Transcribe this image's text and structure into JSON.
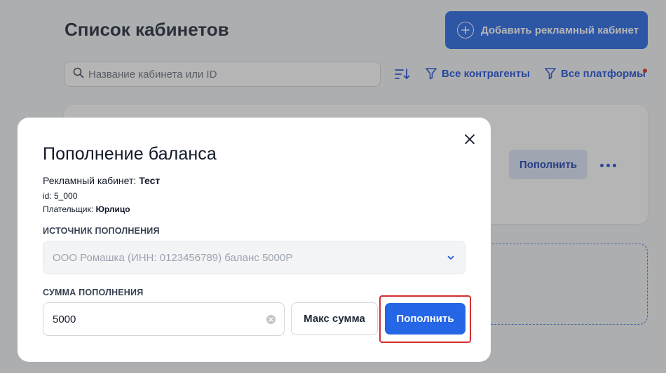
{
  "page": {
    "title": "Список кабинетов",
    "add_button_label": "Добавить рекламный кабинет",
    "search_placeholder": "Название кабинета или ID",
    "filter_contragents": "Все контрагенты",
    "filter_platforms": "Все платформы",
    "card_topup_label": "Пополнить"
  },
  "modal": {
    "title": "Пополнение баланса",
    "account_label": "Рекламный кабинет:",
    "account_name": "Тест",
    "id_text": "id: 5_000",
    "payer_label": "Плательщик:",
    "payer_name": "Юрлицо",
    "source_label": "ИСТОЧНИК ПОПОЛНЕНИЯ",
    "source_value": "ООО Ромашка (ИНН: 0123456789) баланс 5000Р",
    "amount_label": "СУММА ПОПОЛНЕНИЯ",
    "amount_value": "5000",
    "max_button_label": "Макс сумма",
    "submit_button_label": "Пополнить"
  },
  "colors": {
    "primary": "#2466e6",
    "highlight": "#d32f2f",
    "filter_dot": "#dc2626"
  }
}
